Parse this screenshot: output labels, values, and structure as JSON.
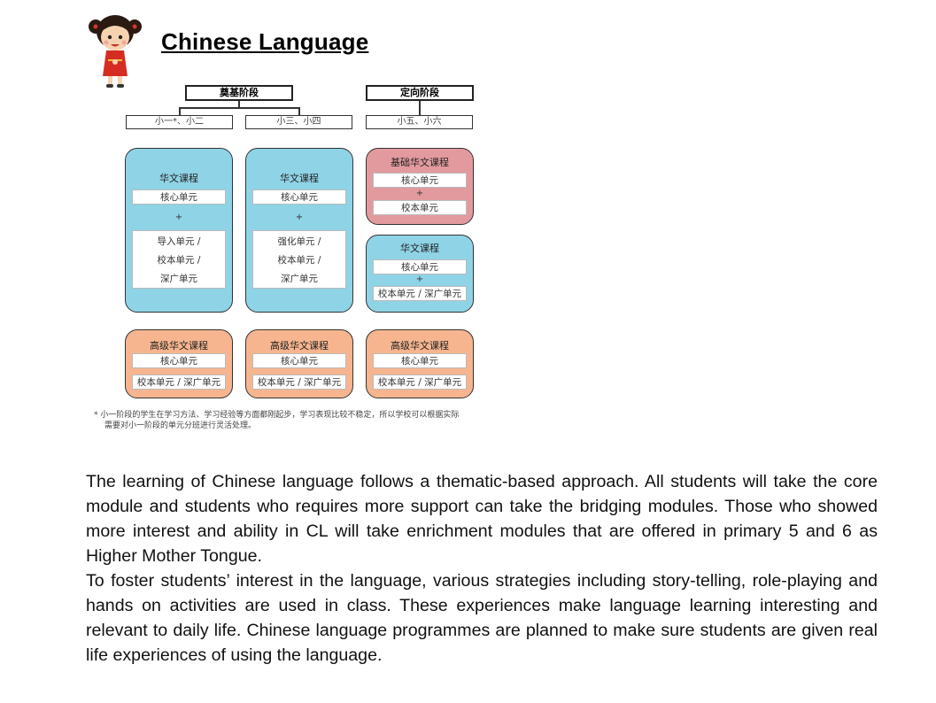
{
  "page": {
    "title": "Chinese Language"
  },
  "diagram": {
    "stage1": "奠基阶段",
    "stage2": "定向阶段",
    "level1": "小一*、小二",
    "level2": "小三、小四",
    "level3": "小五、小六",
    "col1_main": {
      "title": "华文课程",
      "core": "核心单元",
      "plus": "+",
      "options": [
        "导入单元 /",
        "校本单元 /",
        "深广单元"
      ]
    },
    "col2_main": {
      "title": "华文课程",
      "core": "核心单元",
      "plus": "+",
      "options": [
        "强化单元 /",
        "校本单元 /",
        "深广单元"
      ]
    },
    "col3_foundation": {
      "title": "基础华文课程",
      "core": "核心单元",
      "plus": "+",
      "school": "校本单元"
    },
    "col3_main": {
      "title": "华文课程",
      "core": "核心单元",
      "plus": "+",
      "school": "校本单元 / 深广单元"
    },
    "higher": {
      "title": "高级华文课程",
      "core": "核心单元",
      "school": "校本单元 / 深广单元"
    },
    "note_line1": "* 小一阶段的学生在学习方法、学习经验等方面都刚起步，学习表现比较不稳定，所以学校可以根据实际",
    "note_line2": "需要对小一阶段的单元分班进行灵活处理。"
  },
  "body_text": {
    "para1": "The learning of Chinese language follows a thematic-based approach. All students will take the core module and students who requires more support can take the bridging modules. Those who showed more interest and ability in CL will take enrichment modules that are offered in primary 5 and 6 as Higher Mother Tongue.",
    "para2": "To foster students’ interest in the language, various strategies including story-telling, role-playing and hands on activities are used in class. These experiences make language learning interesting and relevant to daily life. Chinese language programmes are planned to make sure students are given real life experiences of using the language."
  },
  "colors": {
    "blue_card": "#8fd3e6",
    "pink_card": "#e39a9e",
    "orange_card": "#f6b58f"
  },
  "icons": {
    "mascot": "chinese-girl-mascot"
  }
}
